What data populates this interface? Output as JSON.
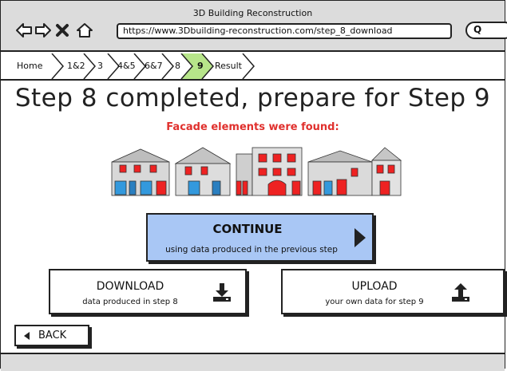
{
  "window": {
    "title": "3D Building Reconstruction"
  },
  "browser": {
    "url": "https://www.3Dbuilding-reconstruction.com/step_8_download"
  },
  "breadcrumbs": [
    {
      "label": "Home"
    },
    {
      "label": "1&2"
    },
    {
      "label": "3"
    },
    {
      "label": "4&5"
    },
    {
      "label": "6&7"
    },
    {
      "label": "8"
    },
    {
      "label": "9"
    },
    {
      "label": "Result"
    }
  ],
  "main": {
    "heading": "Step 8 completed, prepare for Step 9",
    "found_text": "Facade elements were found:",
    "continue": {
      "title": "CONTINUE",
      "subtitle": "using data produced in the previous step"
    },
    "download": {
      "title": "DOWNLOAD",
      "subtitle": "data produced in step 8"
    },
    "upload": {
      "title": "UPLOAD",
      "subtitle": "your own data for step 9"
    },
    "back_label": "BACK"
  },
  "colors": {
    "accent_blue": "#a9c7f5",
    "alert_red": "#e0302d",
    "active_crumb": "#b7e58a",
    "chrome_gray": "#dcdcdc"
  },
  "icons": [
    "back-arrow-icon",
    "forward-arrow-icon",
    "close-icon",
    "home-icon",
    "search-icon",
    "download-icon",
    "upload-icon",
    "play-arrow-icon",
    "back-triangle-icon"
  ]
}
